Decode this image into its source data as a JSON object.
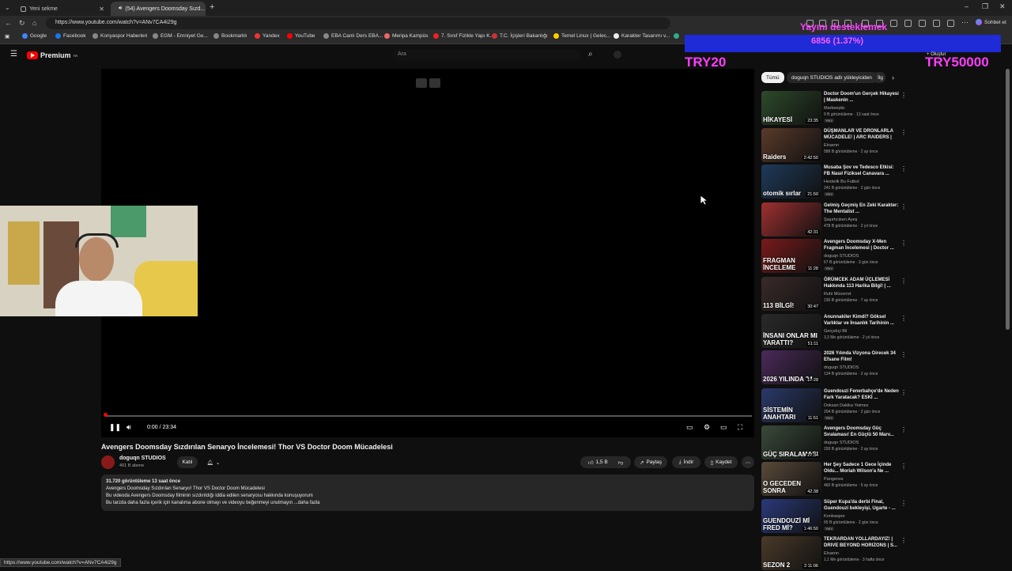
{
  "browser": {
    "tabs": [
      {
        "label": "Yeni sekme",
        "active": false
      },
      {
        "label": "(54) Avengers Doomsday Sızd...",
        "active": true
      }
    ],
    "new_tab": "+",
    "url": "https://www.youtube.com/watch?v=ANv7CA4i29g",
    "bookmarks": [
      "Google",
      "Facebook",
      "Konyaspor Haberleri",
      "EGM - Emniyet Ge...",
      "Bookmarklı",
      "Yandex",
      "YouTube",
      "EBA Canlı Ders EBA...",
      "Meripa Kampüs",
      "7. Sınıf Fizikle Yapı K...",
      "T.C. İçişleri Bakanlığı",
      "Temel Linux | Gelec...",
      "Karakter Tasarımı v..."
    ],
    "profile_label": "Sohbet et",
    "status_url": "https://www.youtube.com/watch?v=ANv7CA4i29g"
  },
  "youtube": {
    "logo_text": "Premium",
    "logo_sup": "TR",
    "search_placeholder": "Ara",
    "create_label": "+ Oluştur"
  },
  "overlay": {
    "donation_label": "Yayını desteklemek",
    "donation_amount": "6856 (1.37%)",
    "left_code": "TRY20",
    "right_code": "TRY50000",
    "bar_color": "#1e2bd6"
  },
  "player": {
    "time": "0:00 / 23:34",
    "progress_fraction": 0.0
  },
  "video": {
    "title": "Avengers Doomsday Sızdırılan Senaryo İncelemesi! Thor VS Doctor Doom Mücadelesi",
    "channel": "doguqn STUDIOS",
    "subscribers": "401 B abone",
    "join_label": "Katıl",
    "likes": "1,5 B",
    "share_label": "Paylaş",
    "download_label": "İndir",
    "save_label": "Kaydet",
    "description": {
      "meta": "31.720 görüntüleme  13 saat önce",
      "line1": "Avengers Doomsday Sızdırılan Senaryo! Thor VS Doctor Doom Mücadelesi",
      "line2": "Bu videoda Avengers Doomsday filminin sızdırıldığı iddia edilen senaryosu hakkında konuşuyorum",
      "line3": "Bu tarzda daha fazla içerik için kanalıma abone olmayı ve videoyu beğenmeyi unutmayın  ...daha fazla"
    }
  },
  "sidebar": {
    "chips": [
      "Tümü",
      "doguqn STUDIOS adlı yükleyiciden",
      "İlg"
    ],
    "recommendations": [
      {
        "title": "Doctor Doom'un Gerçek Hikayesi | Maskenin ...",
        "channel": "Markeeptic",
        "meta": "9 B görüntüleme · 13 saat önce",
        "badge": "Yeni",
        "duration": "23:35",
        "thumb_text": "HİKAYESİ",
        "color": "#2d4a2a"
      },
      {
        "title": "DÜŞMANLAR VE DRONLARLA MÜCADELE! | ARC RAIDERS |",
        "channel": "Elraenn",
        "meta": "589 B görüntüleme · 2 ay önce",
        "badge": "",
        "duration": "2:42:50",
        "thumb_text": "Raiders",
        "color": "#5a3a2a"
      },
      {
        "title": "Musaba Şov ve Tedesco Etkisi: FB Nasıl Fiziksel Canavara ...",
        "channel": "Hesteilk Bu Futbol",
        "meta": "241 B görüntüleme · 2 gün önce",
        "badge": "Yeni",
        "duration": "21:50",
        "thumb_text": "otomik sırlar",
        "color": "#1e3a5a"
      },
      {
        "title": "Gelmiş Geçmiş En Zeki Karakter: The Mentalist ...",
        "channel": "Şaşırtıcıken Ayeş",
        "meta": "478 B görüntüleme · 2 yıl önce",
        "badge": "",
        "duration": "42:31",
        "thumb_text": "",
        "color": "#a03030"
      },
      {
        "title": "Avengers Doomsday X-Men Fragman İncelemesi | Doctor ...",
        "channel": "doguqn STUDIOS",
        "meta": "67 B görüntüleme · 3 gün önce",
        "badge": "Yeni",
        "duration": "11:28",
        "thumb_text": "FRAGMAN İNCELEME",
        "color": "#7a1a1a"
      },
      {
        "title": "ÖRÜMCEK ADAM ÜÇLEMESİ Hakkında 113 Harika Bilgi! | ...",
        "channel": "Ruhi Mücerret",
        "meta": "236 B görüntüleme · 7 ay önce",
        "badge": "",
        "duration": "30:47",
        "thumb_text": "113 BİLGİ!",
        "color": "#3a2a2a"
      },
      {
        "title": "Anunnakiler Kimdi? Göksel Varlıklar ve İnsanlık Tarihinin ...",
        "channel": "Gerçekçi Bil",
        "meta": "3,3 Mn görüntüleme · 2 yıl önce",
        "badge": "",
        "duration": "51:11",
        "thumb_text": "İNSANI ONLAR MI YARATTI?",
        "color": "#2a2a2a"
      },
      {
        "title": "2026 Yılında Vizyona Girecek 34 Efsane Film!",
        "channel": "doguqn STUDIOS",
        "meta": "134 B görüntüleme · 2 ay önce",
        "badge": "",
        "duration": "17:28",
        "thumb_text": "2026 YILINDA 34",
        "color": "#4a2a5a"
      },
      {
        "title": "Guendouzi Fenerbahçe'de Neden Fark Yaratacak? ESKİ ...",
        "channel": "Doksan Dakika Yetmez",
        "meta": "204 B görüntüleme · 2 gün önce",
        "badge": "Yeni",
        "duration": "11:51",
        "thumb_text": "SİSTEMİN ANAHTARI",
        "color": "#2a3a6a"
      },
      {
        "title": "Avengers Doomsday Güç Sıralaması! En Güçlü 50 Marv...",
        "channel": "doguqn STUDIOS",
        "meta": "150 B görüntüleme · 2 ay önce",
        "badge": "",
        "duration": "27:34",
        "thumb_text": "GÜÇ SIRALAMASI",
        "color": "#3a4a3a"
      },
      {
        "title": "Her Şey Sadece 1 Gece İçinde Oldu... Moriah Wilson'a Ne ...",
        "channel": "Pangeoss",
        "meta": "460 B görüntüleme · 5 ay önce",
        "badge": "",
        "duration": "42:38",
        "thumb_text": "O GECEDEN SONRA",
        "color": "#5a4a3a"
      },
      {
        "title": "Süper Kupa'da derbi Final, Guendouzi bekleyişi, Ugarte - ...",
        "channel": "Kontraspor",
        "meta": "65 B görüntüleme · 2 gün önce",
        "badge": "Yeni",
        "duration": "1:46:50",
        "thumb_text": "GUENDOUZİ Mİ FRED Mİ?",
        "color": "#2a3a7a"
      },
      {
        "title": "TEKRARDAN YOLLARDAYIZ! | DRIVE BEYOND HORIZONS | S...",
        "channel": "Elraenn",
        "meta": "1,1 Mn görüntüleme · 3 hafta önce",
        "badge": "",
        "duration": "2:11:06",
        "thumb_text": "SEZON 2",
        "color": "#4a3a2a"
      }
    ]
  }
}
